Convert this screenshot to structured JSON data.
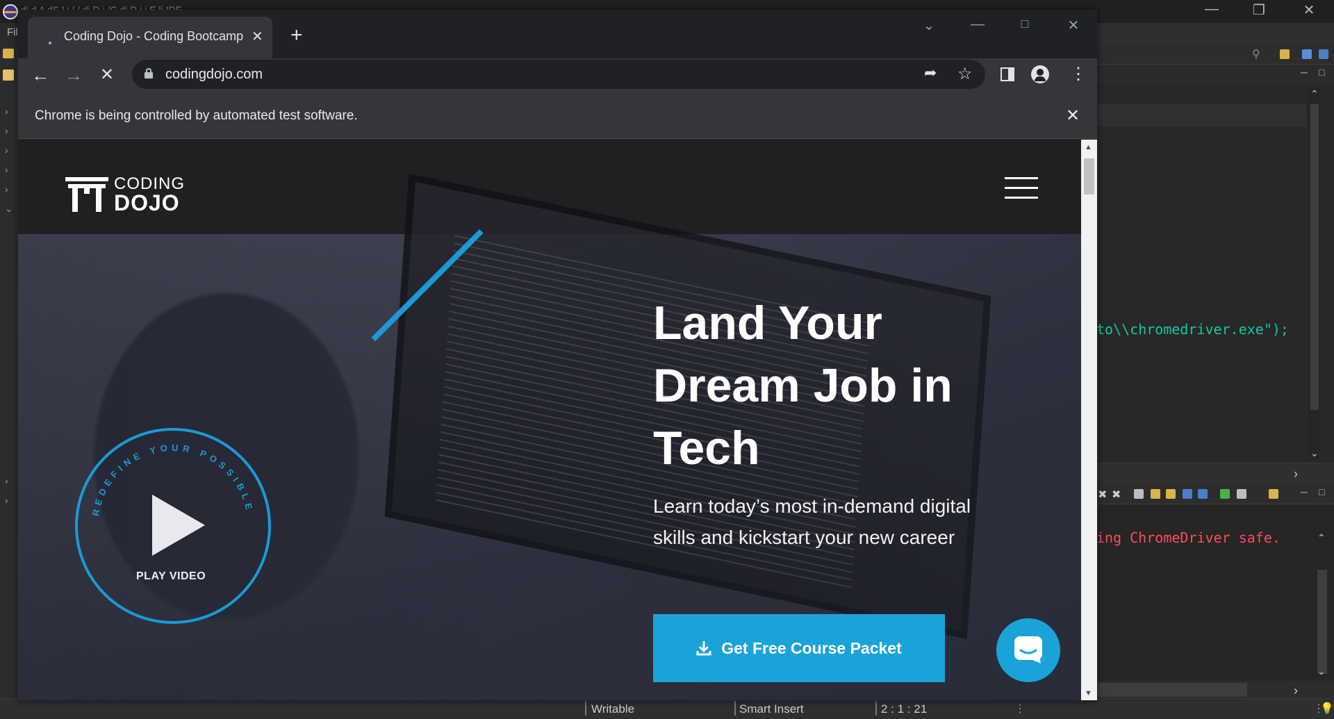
{
  "ide": {
    "title": "di                 d  A  dS l  i     /   /  di  D j /C di  D i i        E li     IDE",
    "menu_file": "Fil",
    "code_line": "to\\\\chromedriver.exe\");",
    "console_line": "ing ChromeDriver safe.",
    "status": {
      "writable": "Writable",
      "insert_mode": "Smart Insert",
      "position": "2 : 1 : 21"
    }
  },
  "browser": {
    "tab_title": "Coding Dojo - Coding Bootcamp",
    "url": "codingdojo.com",
    "infobar_text": "Chrome is being controlled by automated test software.",
    "icons": {
      "back": "back-arrow-icon",
      "forward": "forward-arrow-icon",
      "stop": "stop-loading-icon",
      "share": "share-icon",
      "bookmark": "star-icon",
      "side_panel": "side-panel-icon",
      "profile": "profile-icon",
      "menu": "kebab-menu-icon"
    }
  },
  "site": {
    "logo": {
      "top": "CODING",
      "bottom": "DOJO"
    },
    "hero": {
      "heading": "Land Your Dream Job in Tech",
      "subheading": "Learn today’s most in-demand digital skills and kickstart your new career",
      "cta_label": "Get Free Course Packet",
      "play_label": "PLAY VIDEO",
      "ring_text": "REDEFINE YOUR POSSIBLE"
    },
    "colors": {
      "accent": "#1aa3d8",
      "header_bg": "#202022",
      "text": "#ffffff"
    }
  }
}
